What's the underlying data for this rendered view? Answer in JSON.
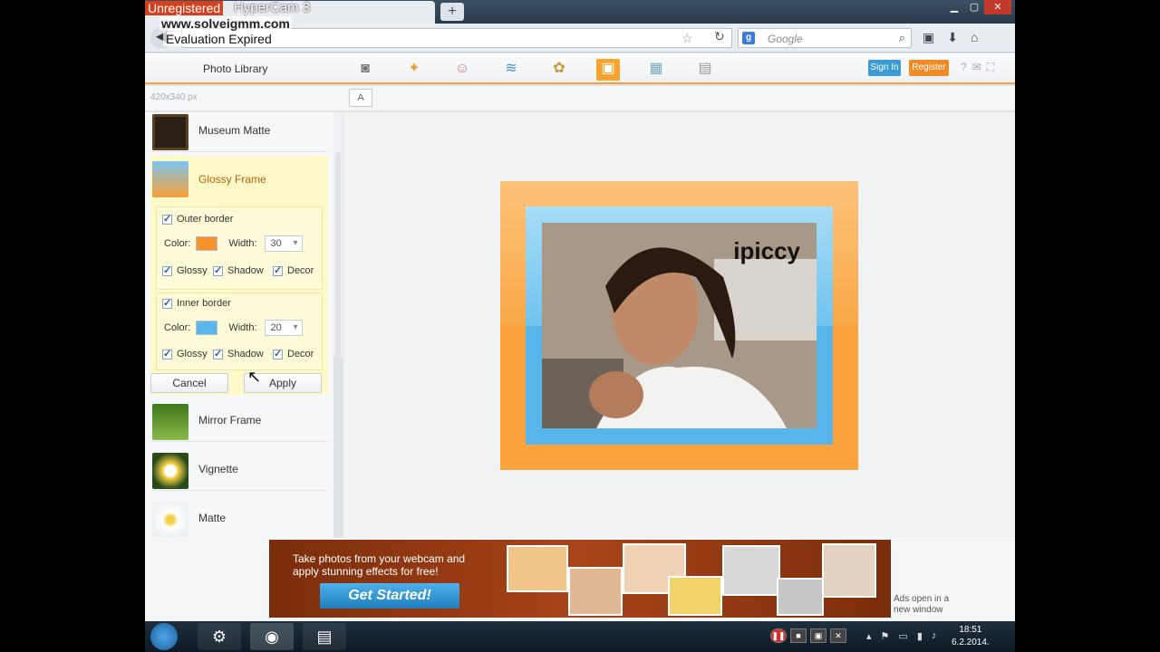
{
  "watermark": {
    "unregistered": "Unregistered",
    "app": "HyperCam 3",
    "site": "www.solveigmm.com",
    "status": "Evaluation Expired"
  },
  "browser": {
    "new_tab": "+",
    "search_placeholder": "Google"
  },
  "toolbar": {
    "photo_library": "Photo Library",
    "icons": [
      "camera-icon",
      "magic-wand-icon",
      "face-icon",
      "layers-icon",
      "art-icon",
      "frame-icon",
      "texture-icon",
      "save-icon"
    ],
    "active_icon": "frame-icon",
    "sign_in": "Sign In",
    "register": "Register"
  },
  "subtoolbar": {
    "size": "420x340 px",
    "text_tool": "A"
  },
  "effects": {
    "items": [
      {
        "label": "Museum Matte"
      },
      {
        "label": "Glossy Frame"
      },
      {
        "label": "Mirror Frame"
      },
      {
        "label": "Vignette"
      },
      {
        "label": "Matte"
      }
    ],
    "selected": "Glossy Frame"
  },
  "glossy_frame": {
    "outer": {
      "label": "Outer border",
      "color_label": "Color:",
      "color": "#f7932a",
      "width_label": "Width:",
      "width": "30",
      "glossy": "Glossy",
      "shadow": "Shadow",
      "decor": "Decor"
    },
    "inner": {
      "label": "Inner border",
      "color_label": "Color:",
      "color": "#5ab6ed",
      "width_label": "Width:",
      "width": "20",
      "glossy": "Glossy",
      "shadow": "Shadow",
      "decor": "Decor"
    },
    "cancel": "Cancel",
    "apply": "Apply"
  },
  "canvas": {
    "caption": "ipiccy"
  },
  "ad": {
    "text": "Take photos from your webcam and apply stunning effects for free!",
    "cta": "Get Started!",
    "note": "Ads open in a new window"
  },
  "taskbar": {
    "time": "18:51",
    "date": "6.2.2014."
  },
  "colors": {
    "accent_orange": "#f9a33a",
    "accent_blue": "#3a9bd5",
    "selected_bg": "#fdf9c8"
  }
}
